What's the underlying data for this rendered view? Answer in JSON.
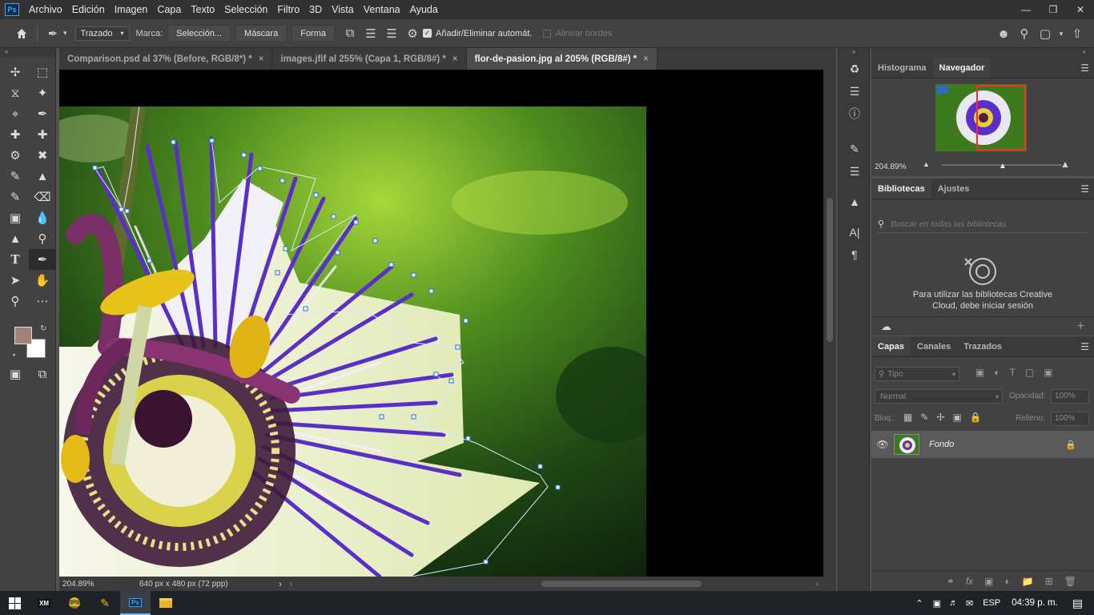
{
  "menubar": {
    "logo": "Ps",
    "items": [
      "Archivo",
      "Edición",
      "Imagen",
      "Capa",
      "Texto",
      "Selección",
      "Filtro",
      "3D",
      "Vista",
      "Ventana",
      "Ayuda"
    ]
  },
  "options": {
    "mode": "Trazado",
    "marca_label": "Marca:",
    "seleccion_btn": "Selección...",
    "mascara_btn": "Máscara",
    "forma_btn": "Forma",
    "auto_add_label": "Añadir/Eliminar automát.",
    "auto_add_checked": true,
    "align_edges_label": "Alinear bordes"
  },
  "tabs": [
    {
      "label": "Comparison.psd al 37% (Before, RGB/8*) *",
      "close": "×"
    },
    {
      "label": "images.jfif al 255% (Capa 1, RGB/8#) *",
      "close": "×"
    },
    {
      "label": "flor-de-pasion.jpg al 205% (RGB/8#) *",
      "close": "×"
    }
  ],
  "status": {
    "zoom": "204.89%",
    "dims": "640 px x 480 px (72 ppp)",
    "arrow": "›"
  },
  "colors": {
    "foreground": "#a58275",
    "background": "#ffffff",
    "accent": "#31a8ff"
  },
  "navigator": {
    "tabs": [
      "Histograma",
      "Navegador"
    ],
    "zoom": "204.89%"
  },
  "libraries": {
    "tabs": [
      "Bibliotecas",
      "Ajustes"
    ],
    "search_placeholder": "Buscar en todas las bibliotecas",
    "message": "Para utilizar las bibliotecas Creative",
    "message2": "Cloud, debe iniciar sesión"
  },
  "layers": {
    "tabs": [
      "Capas",
      "Canales",
      "Trazados"
    ],
    "filter": "Tipo",
    "blend": "Normal",
    "opacity_label": "Opacidad:",
    "opacity": "100%",
    "lock_label": "Bloq.:",
    "fill_label": "Relleno:",
    "fill": "100%",
    "items": [
      {
        "name": "Fondo"
      }
    ]
  },
  "taskbar": {
    "lang": "ESP",
    "time": "04:39 p. m."
  }
}
